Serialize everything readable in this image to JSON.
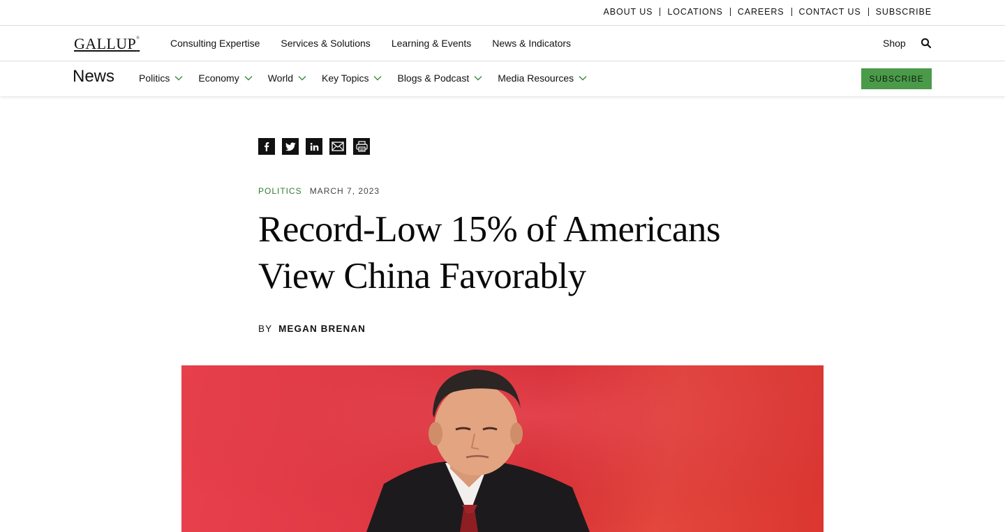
{
  "utility_nav": {
    "links": [
      "ABOUT US",
      "LOCATIONS",
      "CAREERS",
      "CONTACT US",
      "SUBSCRIBE"
    ]
  },
  "main_nav": {
    "logo": "GALLUP",
    "links": [
      "Consulting Expertise",
      "Services & Solutions",
      "Learning & Events",
      "News & Indicators"
    ],
    "shop": "Shop",
    "search_icon": "search-icon"
  },
  "section_nav": {
    "title": "News",
    "items": [
      {
        "label": "Politics"
      },
      {
        "label": "Economy"
      },
      {
        "label": "World"
      },
      {
        "label": "Key Topics"
      },
      {
        "label": "Blogs & Podcast"
      },
      {
        "label": "Media Resources"
      }
    ],
    "subscribe": "SUBSCRIBE"
  },
  "share_icons": [
    "facebook-icon",
    "twitter-icon",
    "linkedin-icon",
    "email-icon",
    "print-icon"
  ],
  "article": {
    "category": "POLITICS",
    "date": "MARCH 7, 2023",
    "title": "Record-Low 15% of Americans View China Favorably",
    "byline_prefix": "BY",
    "author": "MEGAN BRENAN"
  },
  "colors": {
    "accent_green": "#2e7d32",
    "subscribe_bg": "#4b9a4a",
    "hero_red": "#e13a45"
  }
}
